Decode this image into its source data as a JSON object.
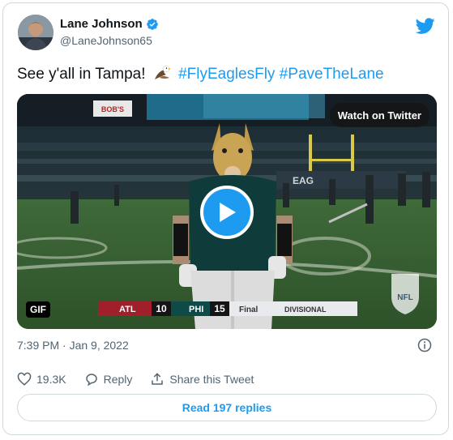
{
  "author": {
    "name": "Lane Johnson",
    "handle": "@LaneJohnson65",
    "verified": true
  },
  "tweet": {
    "text_prefix": "See y'all in Tampa!",
    "emoji": "eagle",
    "hashtags": [
      "#FlyEaglesFly",
      "#PaveTheLane"
    ]
  },
  "media": {
    "watch_label": "Watch on Twitter",
    "gif_badge": "GIF",
    "scoreboard": {
      "team1": "ATL",
      "score1": "10",
      "team2": "PHI",
      "score2": "15",
      "status": "Final",
      "round": "DIVISIONAL"
    },
    "stadium_sign": "BOB'S"
  },
  "timestamp": "7:39 PM · Jan 9, 2022",
  "actions": {
    "likes": "19.3K",
    "reply_label": "Reply",
    "share_label": "Share this Tweet"
  },
  "read_replies": "Read 197 replies",
  "colors": {
    "accent": "#1d9bf0",
    "text": "#0f1419",
    "muted": "#536471",
    "border": "#cfd9de"
  }
}
